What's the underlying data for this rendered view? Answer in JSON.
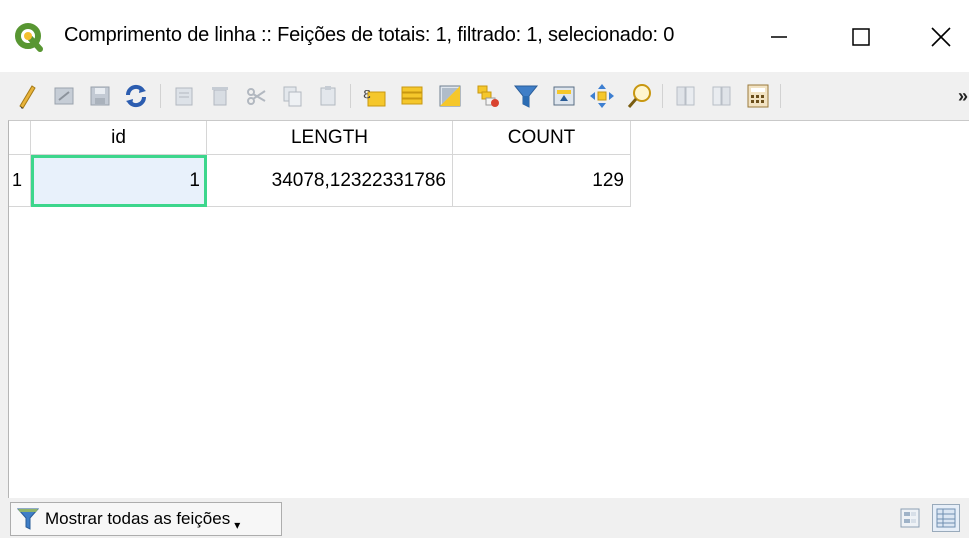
{
  "window": {
    "title": "Comprimento de linha :: Feições de totais: 1, filtrado: 1, selecionado: 0",
    "app_icon": "qgis-icon",
    "controls": [
      "minimize-icon",
      "maximize-icon",
      "close-icon"
    ]
  },
  "toolbar": {
    "buttons": [
      "toggle-editing-icon",
      "toggle-multi-edit-icon",
      "save-edits-icon",
      "reload-table-icon",
      "add-feature-icon",
      "delete-features-icon",
      "cut-icon",
      "copy-icon",
      "paste-icon",
      "expression-select-icon",
      "select-all-icon",
      "invert-selection-icon",
      "deselect-all-icon",
      "filter-select-icon",
      "move-selection-top-icon",
      "pan-to-selection-icon",
      "zoom-to-selection-icon",
      "new-field-icon",
      "delete-field-icon",
      "field-calculator-icon"
    ],
    "overflow_label": "»"
  },
  "table": {
    "columns": [
      "id",
      "LENGTH",
      "COUNT"
    ],
    "rows": [
      {
        "row_number": "1",
        "id": "1",
        "length": "34078,12322331786",
        "count": "129"
      }
    ],
    "selected_cell": "id"
  },
  "bottom": {
    "filter_label": "Mostrar todas as feições",
    "filter_icon": "filter-icon",
    "view_buttons": [
      "form-view-icon",
      "table-view-icon"
    ],
    "active_view": "table"
  },
  "colors": {
    "selection_border": "#3dd68c",
    "selection_fill": "#e8f1fb",
    "qgis_green": "#589632",
    "qgis_yellow": "#f3bf2e"
  }
}
